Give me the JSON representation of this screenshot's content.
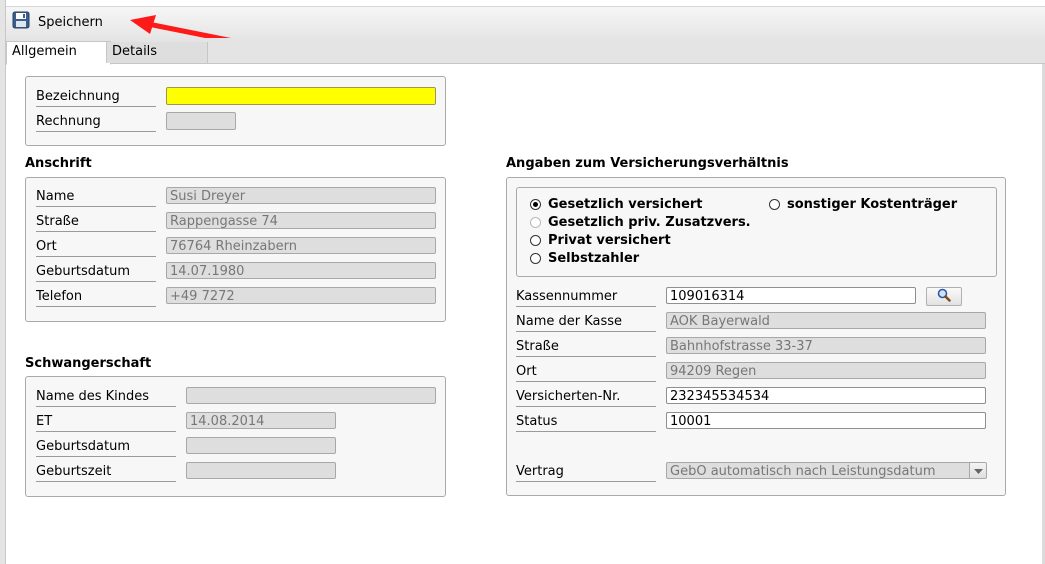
{
  "toolbar": {
    "save_label": "Speichern"
  },
  "tabs": [
    {
      "label": "Allgemein",
      "active": true
    },
    {
      "label": "Details",
      "active": false
    }
  ],
  "general": {
    "bezeichnung_label": "Bezeichnung",
    "bezeichnung_value": "",
    "rechnung_label": "Rechnung",
    "rechnung_value": ""
  },
  "address": {
    "title": "Anschrift",
    "fields": [
      {
        "label": "Name",
        "value": "Susi Dreyer"
      },
      {
        "label": "Straße",
        "value": "Rappengasse 74"
      },
      {
        "label": "Ort",
        "value": "76764 Rheinzabern"
      },
      {
        "label": "Geburtsdatum",
        "value": "14.07.1980"
      },
      {
        "label": "Telefon",
        "value": "+49 7272"
      }
    ]
  },
  "pregnancy": {
    "title": "Schwangerschaft",
    "fields": [
      {
        "label": "Name des Kindes",
        "value": ""
      },
      {
        "label": "ET",
        "value": "14.08.2014"
      },
      {
        "label": "Geburtsdatum",
        "value": ""
      },
      {
        "label": "Geburtszeit",
        "value": ""
      }
    ]
  },
  "insurance": {
    "title": "Angaben zum Versicherungsverhältnis",
    "options": [
      {
        "label": "Gesetzlich versichert",
        "checked": true,
        "enabled": true
      },
      {
        "label": "Gesetzlich priv. Zusatzvers.",
        "checked": false,
        "enabled": false
      },
      {
        "label": "Privat versichert",
        "checked": false,
        "enabled": true
      },
      {
        "label": "Selbstzahler",
        "checked": false,
        "enabled": true
      },
      {
        "label": "sonstiger Kostenträger",
        "checked": false,
        "enabled": true
      }
    ],
    "fields": [
      {
        "label": "Kassennummer",
        "value": "109016314"
      },
      {
        "label": "Name der Kasse",
        "value": "AOK Bayerwald"
      },
      {
        "label": "Straße",
        "value": "Bahnhofstrasse 33-37"
      },
      {
        "label": "Ort",
        "value": "94209 Regen"
      },
      {
        "label": "Versicherten-Nr.",
        "value": "232345534534"
      },
      {
        "label": "Status",
        "value": "10001"
      }
    ],
    "contract_label": "Vertrag",
    "contract_value": "GebO automatisch nach Leistungsdatum"
  },
  "colors": {
    "highlight": "#ffff00",
    "arrow": "#ff0000"
  },
  "icons": {
    "save": "floppy-disk-icon",
    "search": "magnifier-icon",
    "dropdown": "chevron-down-icon"
  }
}
